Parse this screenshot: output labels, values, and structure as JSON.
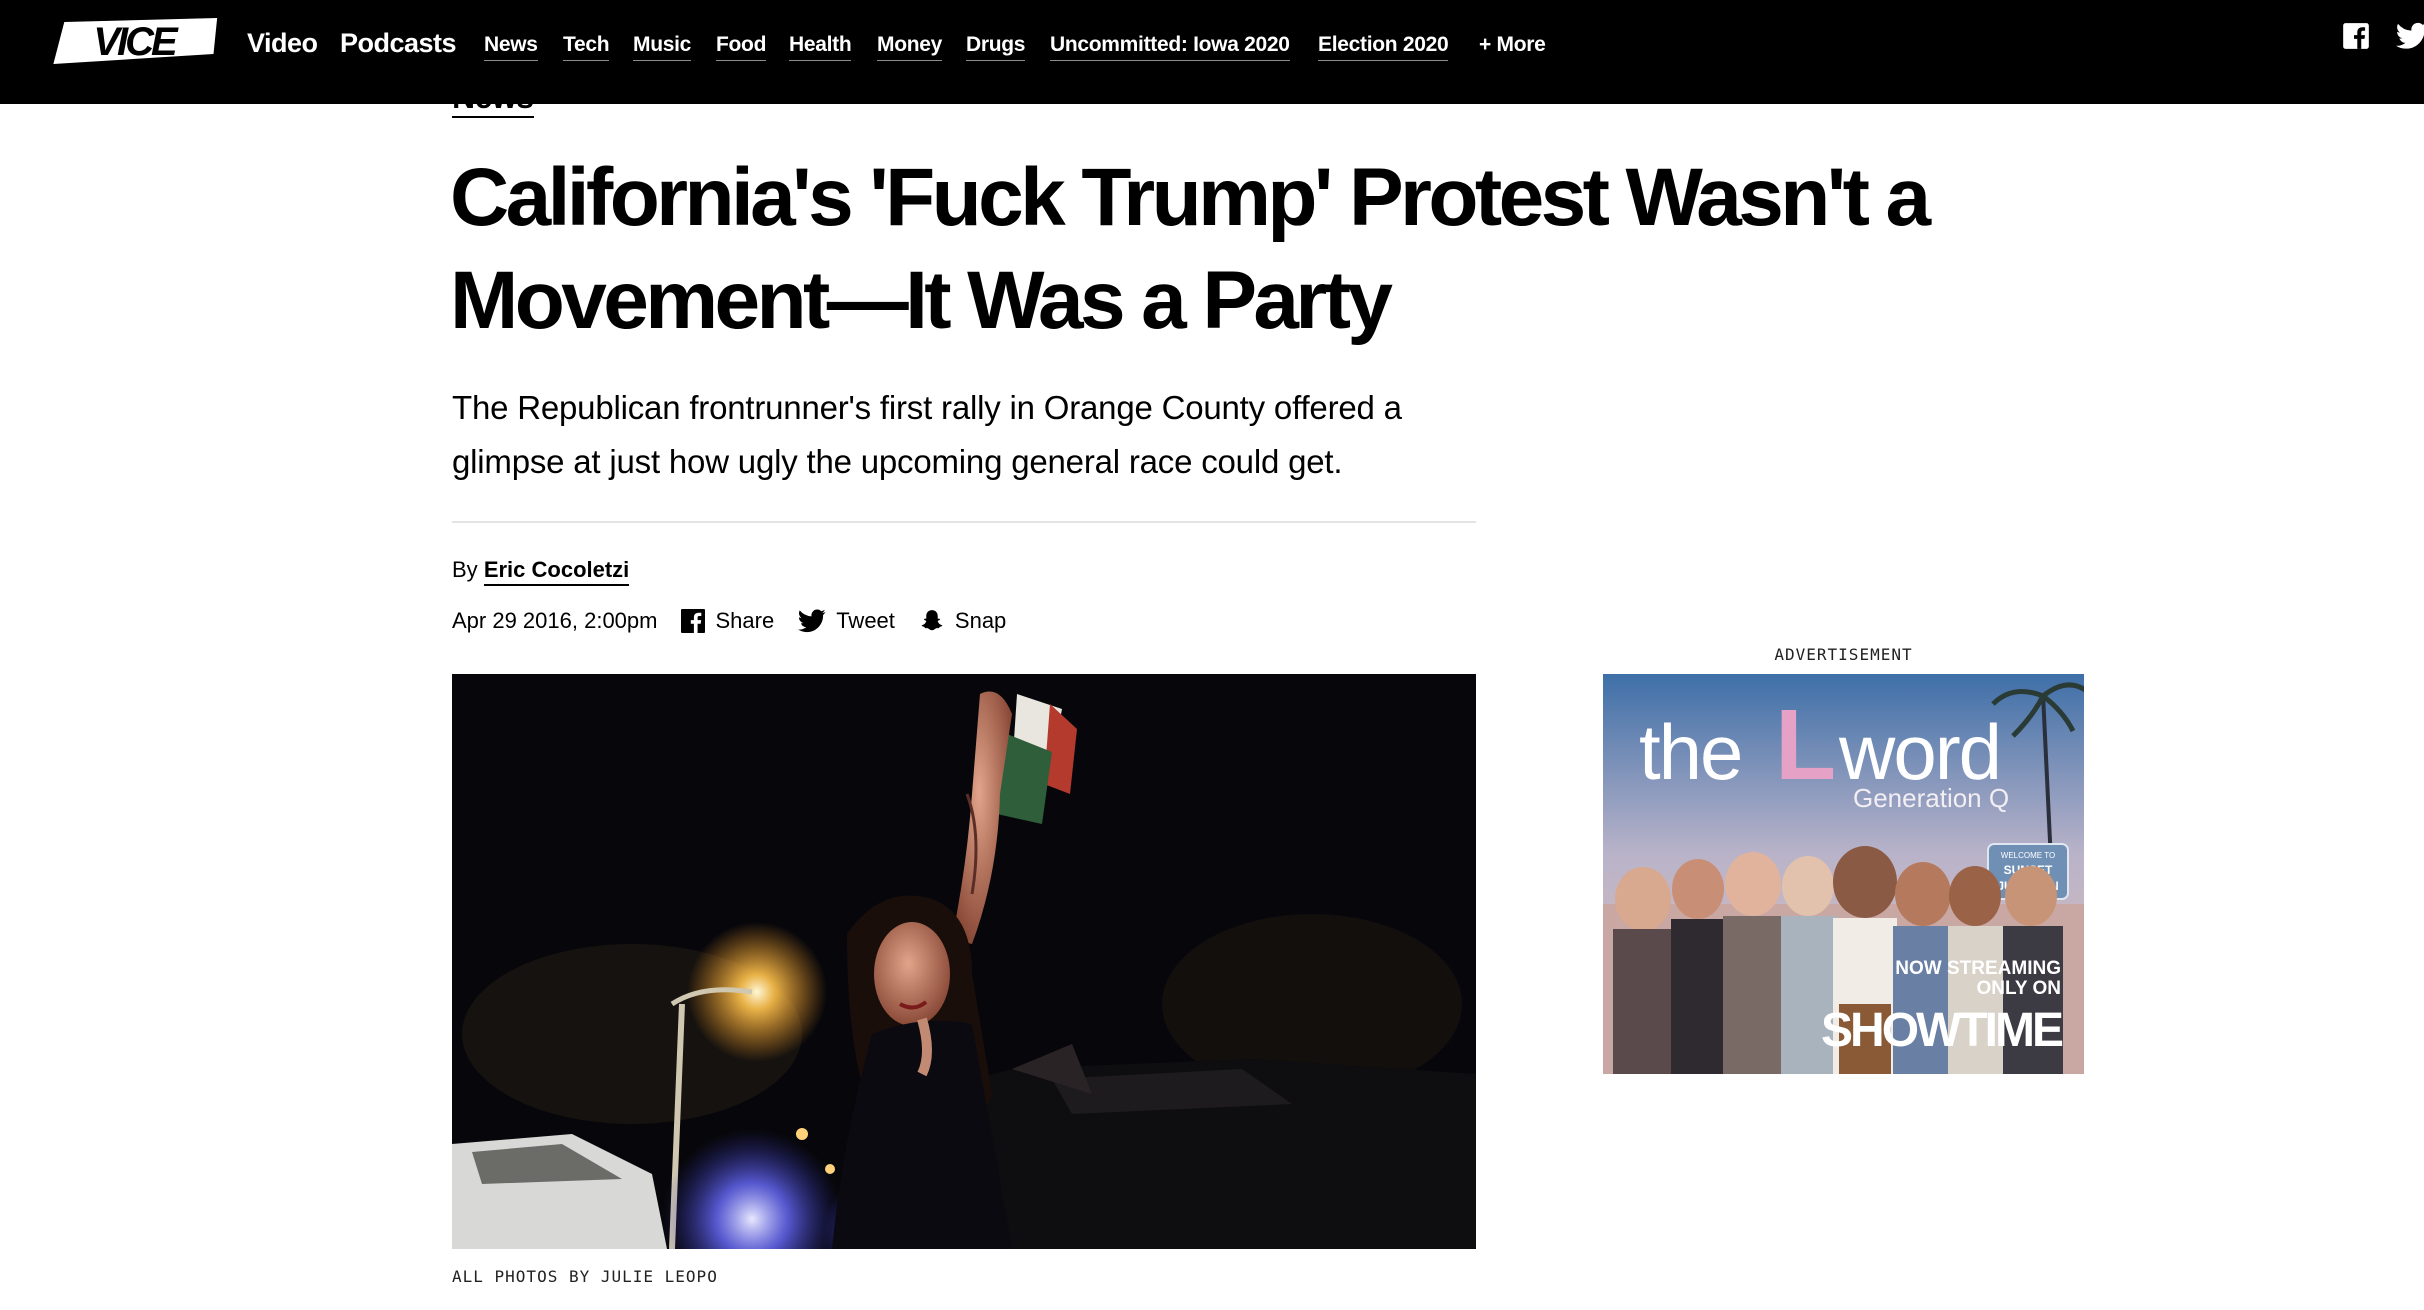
{
  "brand": {
    "logo_text": "VICE"
  },
  "nav": {
    "primary": [
      "Video",
      "Podcasts"
    ],
    "secondary": [
      "News",
      "Tech",
      "Music",
      "Food",
      "Health",
      "Money",
      "Drugs",
      "Uncommitted: Iowa 2020",
      "Election 2020"
    ],
    "more": "+ More",
    "social_icons": [
      "facebook-icon",
      "twitter-icon"
    ]
  },
  "article": {
    "section": "News",
    "headline_line1": "California's 'Fuck Trump' Protest Wasn't a",
    "headline_line2": "Movement—It Was a Party",
    "dek_line1": "The Republican frontrunner's first rally in Orange County offered a",
    "dek_line2": "glimpse at just how ugly the upcoming general race could get.",
    "by_prefix": "By",
    "author": "Eric Cocoletzi",
    "date": "Apr 29 2016, 2:00pm",
    "share": {
      "facebook": "Share",
      "twitter": "Tweet",
      "snapchat": "Snap"
    },
    "photo_caption": "ALL PHOTOS BY JULIE LEOPO"
  },
  "ad": {
    "label": "ADVERTISEMENT",
    "title_the": "the",
    "title_l": "L",
    "title_word": "word",
    "subtitle": "Generation Q",
    "streaming_line1": "NOW STREAMING",
    "streaming_line2": "ONLY ON",
    "network": "SHOWTIME",
    "sign_lines": [
      "WELCOME TO",
      "SUNSET",
      "JUNCTION"
    ]
  },
  "colors": {
    "nav_bg": "#000000",
    "ad_pink": "#e6a2c6",
    "text": "#000000"
  }
}
